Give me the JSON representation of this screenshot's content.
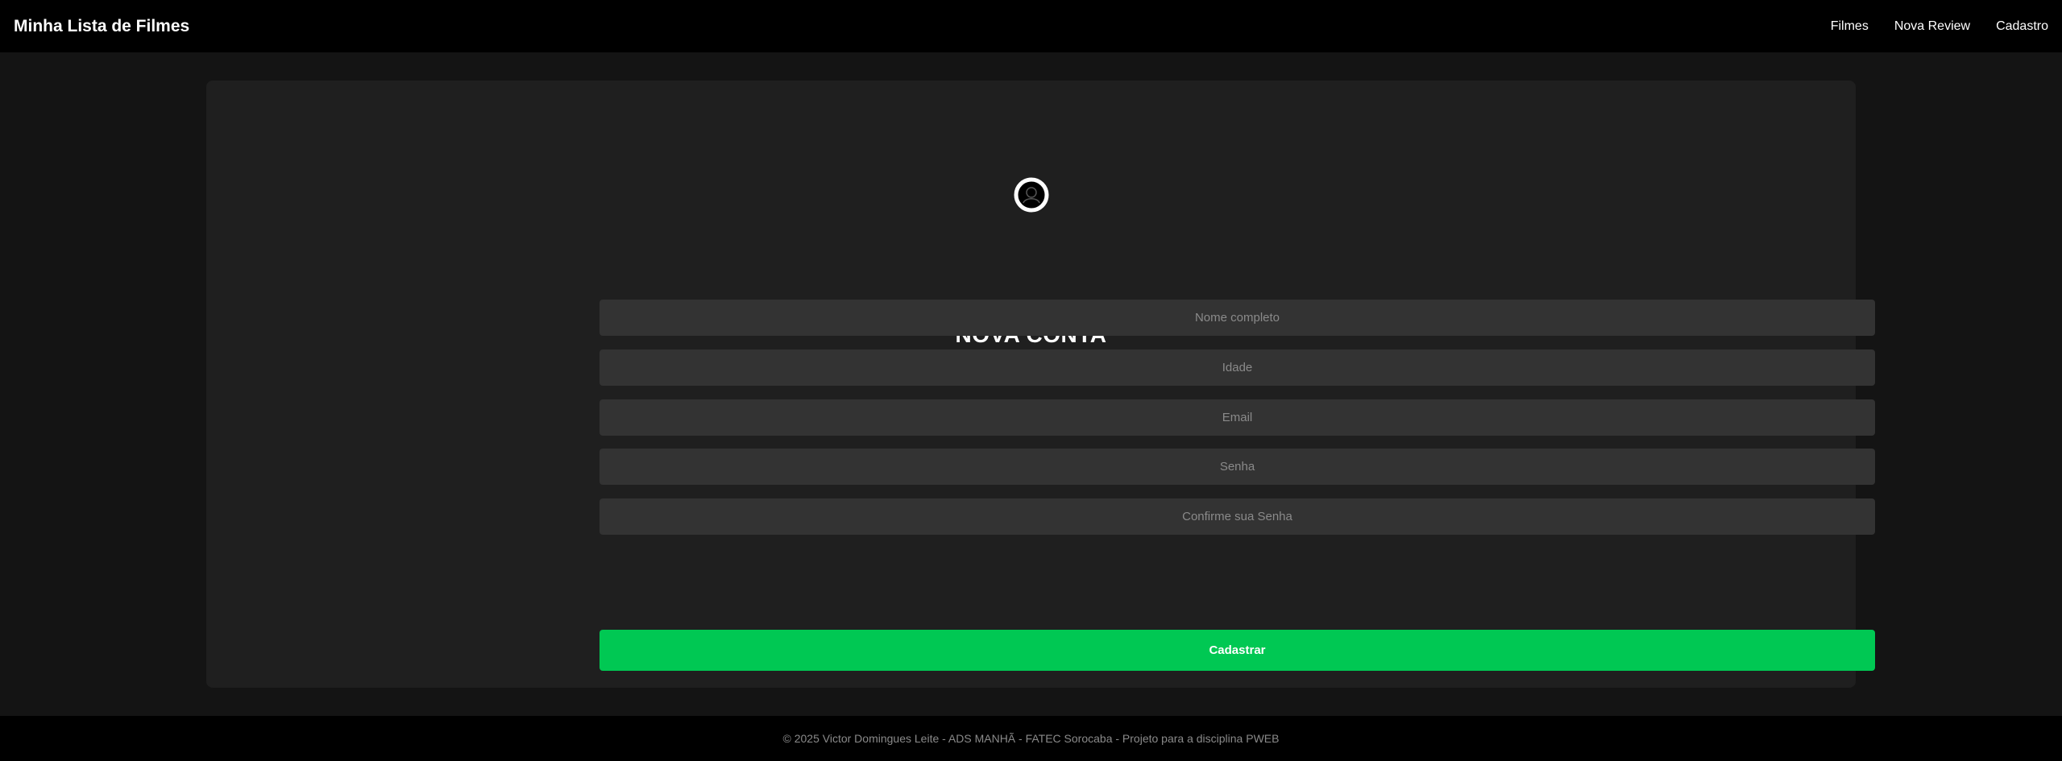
{
  "navbar": {
    "brand": "Minha Lista de Filmes",
    "links": [
      {
        "label": "Filmes"
      },
      {
        "label": "Nova Review"
      },
      {
        "label": "Cadastro"
      }
    ]
  },
  "form": {
    "icon": "user-circle-icon",
    "title": "NOVA CONTA",
    "fields": [
      {
        "placeholder": "Nome completo",
        "value": ""
      },
      {
        "placeholder": "Idade",
        "value": ""
      },
      {
        "placeholder": "Email",
        "value": ""
      },
      {
        "placeholder": "Senha",
        "value": ""
      },
      {
        "placeholder": "Confirme sua Senha",
        "value": ""
      }
    ],
    "submit_label": "Cadastrar"
  },
  "footer": {
    "text": "© 2025 Victor Domingues Leite - ADS MANHÃ - FATEC Sorocaba - Projeto para a disciplina PWEB"
  },
  "colors": {
    "background": "#141414",
    "card": "#1f1f1f",
    "input": "#333333",
    "accent": "#00c853",
    "navbar": "#000000"
  }
}
